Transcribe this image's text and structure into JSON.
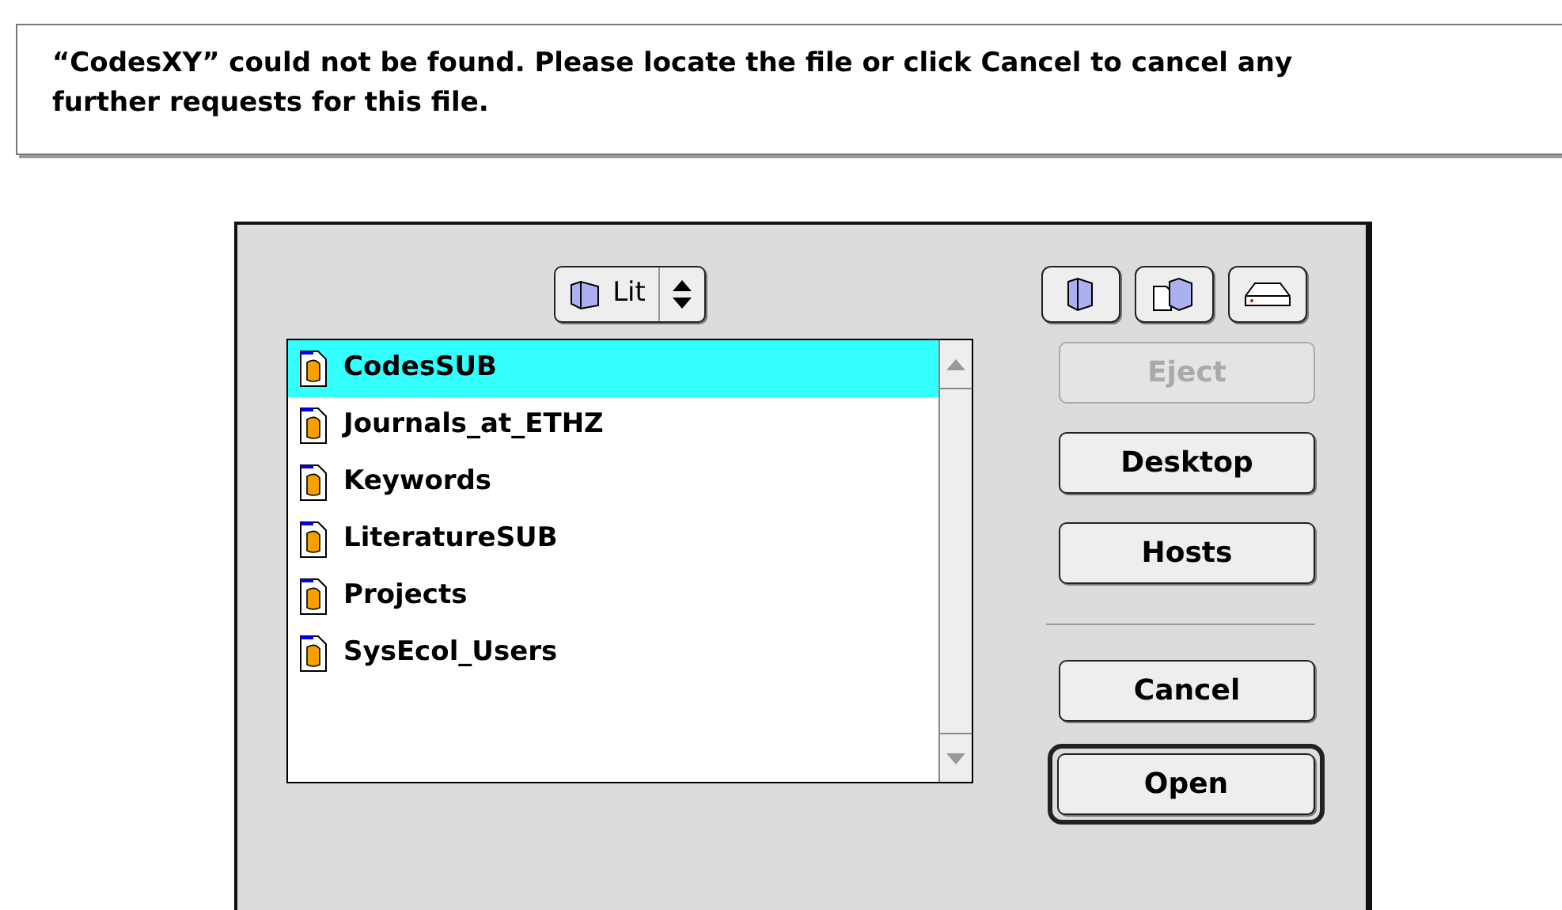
{
  "alert": {
    "message": "“CodesXY” could not be found.  Please locate the file or click Cancel to cancel any further requests for this file."
  },
  "dialog": {
    "folder_popup": {
      "label": "Lit"
    },
    "files": [
      {
        "name": "CodesSUB",
        "selected": true
      },
      {
        "name": "Journals_at_ETHZ",
        "selected": false
      },
      {
        "name": "Keywords",
        "selected": false
      },
      {
        "name": "LiteratureSUB",
        "selected": false
      },
      {
        "name": "Projects",
        "selected": false
      },
      {
        "name": "SysEcol_Users",
        "selected": false
      }
    ],
    "nav_buttons": [
      {
        "label": "Eject",
        "disabled": true
      },
      {
        "label": "Desktop",
        "disabled": false
      },
      {
        "label": "Hosts",
        "disabled": false
      }
    ],
    "action_buttons": [
      {
        "label": "Cancel",
        "default": false
      },
      {
        "label": "Open",
        "default": true
      }
    ]
  }
}
